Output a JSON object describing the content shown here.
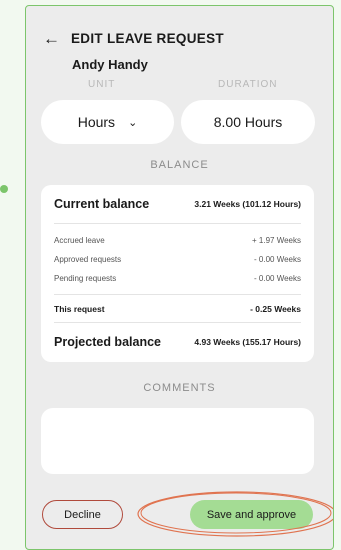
{
  "header": {
    "back_icon": "arrow-left-icon",
    "title": "EDIT LEAVE REQUEST",
    "employee": "Andy Handy"
  },
  "fields": {
    "units_value": "Hours",
    "units_icon": "chevron-down-icon",
    "duration_value": "8.00 Hours"
  },
  "balance": {
    "section_title": "BALANCE",
    "current": {
      "label": "Current balance",
      "value": "3.21 Weeks (101.12 Hours)"
    },
    "details": [
      {
        "label": "Accrued leave",
        "value": "+ 1.97 Weeks"
      },
      {
        "label": "Approved requests",
        "value": "- 0.00 Weeks"
      },
      {
        "label": "Pending requests",
        "value": "- 0.00 Weeks"
      }
    ],
    "this_request": {
      "label": "This request",
      "value": "- 0.25 Weeks"
    },
    "projected": {
      "label": "Projected balance",
      "value": "4.93 Weeks (155.17 Hours)"
    }
  },
  "comments": {
    "section_title": "COMMENTS",
    "value": ""
  },
  "actions": {
    "decline_label": "Decline",
    "approve_label": "Save and approve"
  },
  "colors": {
    "accent_green": "#a4dc94",
    "border_green": "#7cc56b",
    "decline_border": "#b04a3c",
    "annotation_ring": "#e0734f"
  }
}
